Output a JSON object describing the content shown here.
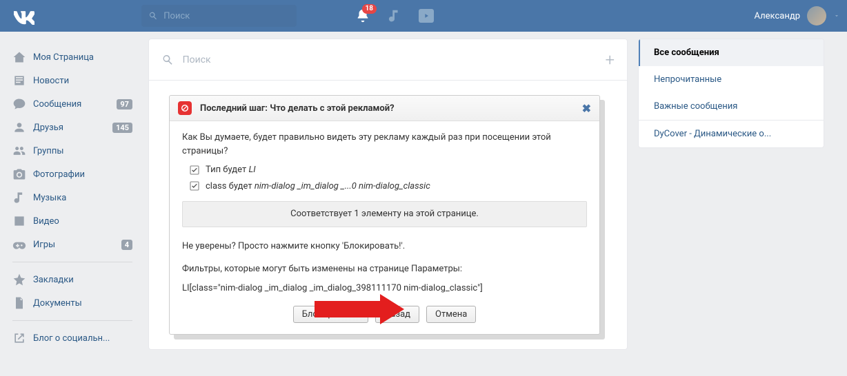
{
  "topbar": {
    "search_placeholder": "Поиск",
    "bell_badge": "18",
    "username": "Александр"
  },
  "sidebar": {
    "items": [
      {
        "label": "Моя Страница"
      },
      {
        "label": "Новости"
      },
      {
        "label": "Сообщения",
        "count": "97"
      },
      {
        "label": "Друзья",
        "count": "145"
      },
      {
        "label": "Группы"
      },
      {
        "label": "Фотографии"
      },
      {
        "label": "Музыка"
      },
      {
        "label": "Видео"
      },
      {
        "label": "Игры",
        "count": "4"
      }
    ],
    "secondary": [
      {
        "label": "Закладки"
      },
      {
        "label": "Документы"
      }
    ],
    "tertiary": [
      {
        "label": "Блог о социальн..."
      }
    ]
  },
  "main": {
    "search_placeholder": "Поиск"
  },
  "filters": {
    "items": [
      {
        "label": "Все сообщения",
        "active": true
      },
      {
        "label": "Непрочитанные"
      },
      {
        "label": "Важные сообщения"
      }
    ],
    "extra": {
      "label": "DyCover - Динамические о..."
    }
  },
  "modal": {
    "title": "Последний шаг: Что делать с этой рекламой?",
    "question": "Как Вы думаете, будет правильно видеть эту рекламу каждый раз при посещении этой страницы?",
    "check1_a": "Тип будет ",
    "check1_b": "LI",
    "check2_a": "class будет ",
    "check2_b": "nim-dialog _im_dialog _...0 nim-dialog_classic",
    "info": "Соответствует 1 элементу на этой странице.",
    "unsure": "Не уверены? Просто нажмите кнопку 'Блокировать!'.",
    "filters_text": "Фильтры, которые могут быть изменены на странице Параметры:",
    "filter_code": "LI[class=\"nim-dialog _im_dialog _im_dialog_398111170 nim-dialog_classic\"]",
    "btn_block": "Блокировать!",
    "btn_back": "Назад",
    "btn_cancel": "Отмена"
  }
}
